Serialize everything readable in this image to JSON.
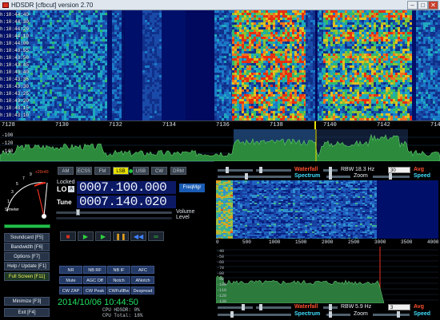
{
  "window": {
    "title": "HDSDR [cfbcut]  version 2.70",
    "minimize": "–",
    "maximize": "□",
    "close": "✕"
  },
  "waterfall": {
    "timestamps": [
      "10:44:40",
      "10:44:30",
      "10:44:20",
      "10:44:10",
      "10:44:00",
      "10:43:55",
      "10:43:50",
      "10:43:45",
      "10:43:40",
      "10:43:35",
      "10:43:30",
      "10:43:25",
      "10:43:20",
      "10:43:15",
      "10:43:10"
    ],
    "freq_ticks": [
      "7128",
      "7130",
      "7132",
      "7134",
      "7136",
      "7138",
      "7140",
      "7142",
      "7144"
    ]
  },
  "spectrum_top": {
    "ticks": [
      "-100",
      "-120",
      "-140"
    ]
  },
  "modes": [
    {
      "label": "AM",
      "active": false
    },
    {
      "label": "ECSS",
      "active": false
    },
    {
      "label": "FM",
      "active": false
    },
    {
      "label": "LSB",
      "active": true
    },
    {
      "label": "USB",
      "active": false
    },
    {
      "label": "CW",
      "active": false
    },
    {
      "label": "DRM",
      "active": false
    }
  ],
  "smeter": {
    "scale": [
      "1",
      "3",
      "5",
      "7",
      "9",
      "+20",
      "+40"
    ],
    "label": "S-meter"
  },
  "sidebar": [
    {
      "label": "Soundcard",
      "key": "[F5]"
    },
    {
      "label": "Bandwidth",
      "key": "[F6]"
    },
    {
      "label": "Options",
      "key": "[F7]"
    },
    {
      "label": "Help / Update",
      "key": "[F1]"
    },
    {
      "label": "Full Screen",
      "key": "[F11]"
    },
    {
      "label": "Minimize",
      "key": "[F3]"
    },
    {
      "label": "Exit",
      "key": "[F4]"
    }
  ],
  "tuning": {
    "locked_label": "Locked",
    "lo_label": "LO",
    "lo_value": "0007.100.000",
    "tune_label": "Tune",
    "tune_value": "0007.140.020",
    "freqmgr": "FreqMgr",
    "volume_label": "Volume",
    "level_label": "Level"
  },
  "transport": [
    "■",
    "▶",
    "▶",
    "❚❚",
    "◀◀",
    "∞"
  ],
  "dsp": {
    "row1": [
      "NR",
      "NB RF",
      "NB IF",
      "AFC"
    ],
    "row2": [
      "Mute",
      "AGC Off",
      "Notch",
      "ANotch"
    ],
    "row3": [
      "CW ZAP",
      "CW Peak",
      "CWFullBw",
      "Despread"
    ]
  },
  "clock": "2014/10/06 10:44:50",
  "cpu": {
    "hdsdr_label": "CPU HDSDR:",
    "hdsdr_value": "0%",
    "total_label": "CPU Total:",
    "total_value": "18%"
  },
  "right_panel": {
    "waterfall_label": "Waterfall",
    "spectrum_label": "Spectrum",
    "rbw_label": "RBW",
    "rbw_top": "18.3 Hz",
    "rbw_bottom": "5.9 Hz",
    "zoom_label": "Zoom",
    "avg_label": "Avg",
    "speed_label": "Speed",
    "dropdown_top": "30",
    "dropdown_bottom": "3",
    "audio_ticks": [
      "0",
      "500",
      "1000",
      "1500",
      "2000",
      "2500",
      "3000",
      "3500",
      "4000"
    ],
    "spec_ticks": [
      "-40",
      "-50",
      "-60",
      "-70",
      "-80",
      "-90",
      "-100",
      "-110",
      "-120",
      "-130"
    ]
  },
  "colors": {
    "accent_yellow": "#e8e000",
    "digit_bg": "#0c1a66",
    "waterfall_base": "#00106a"
  }
}
